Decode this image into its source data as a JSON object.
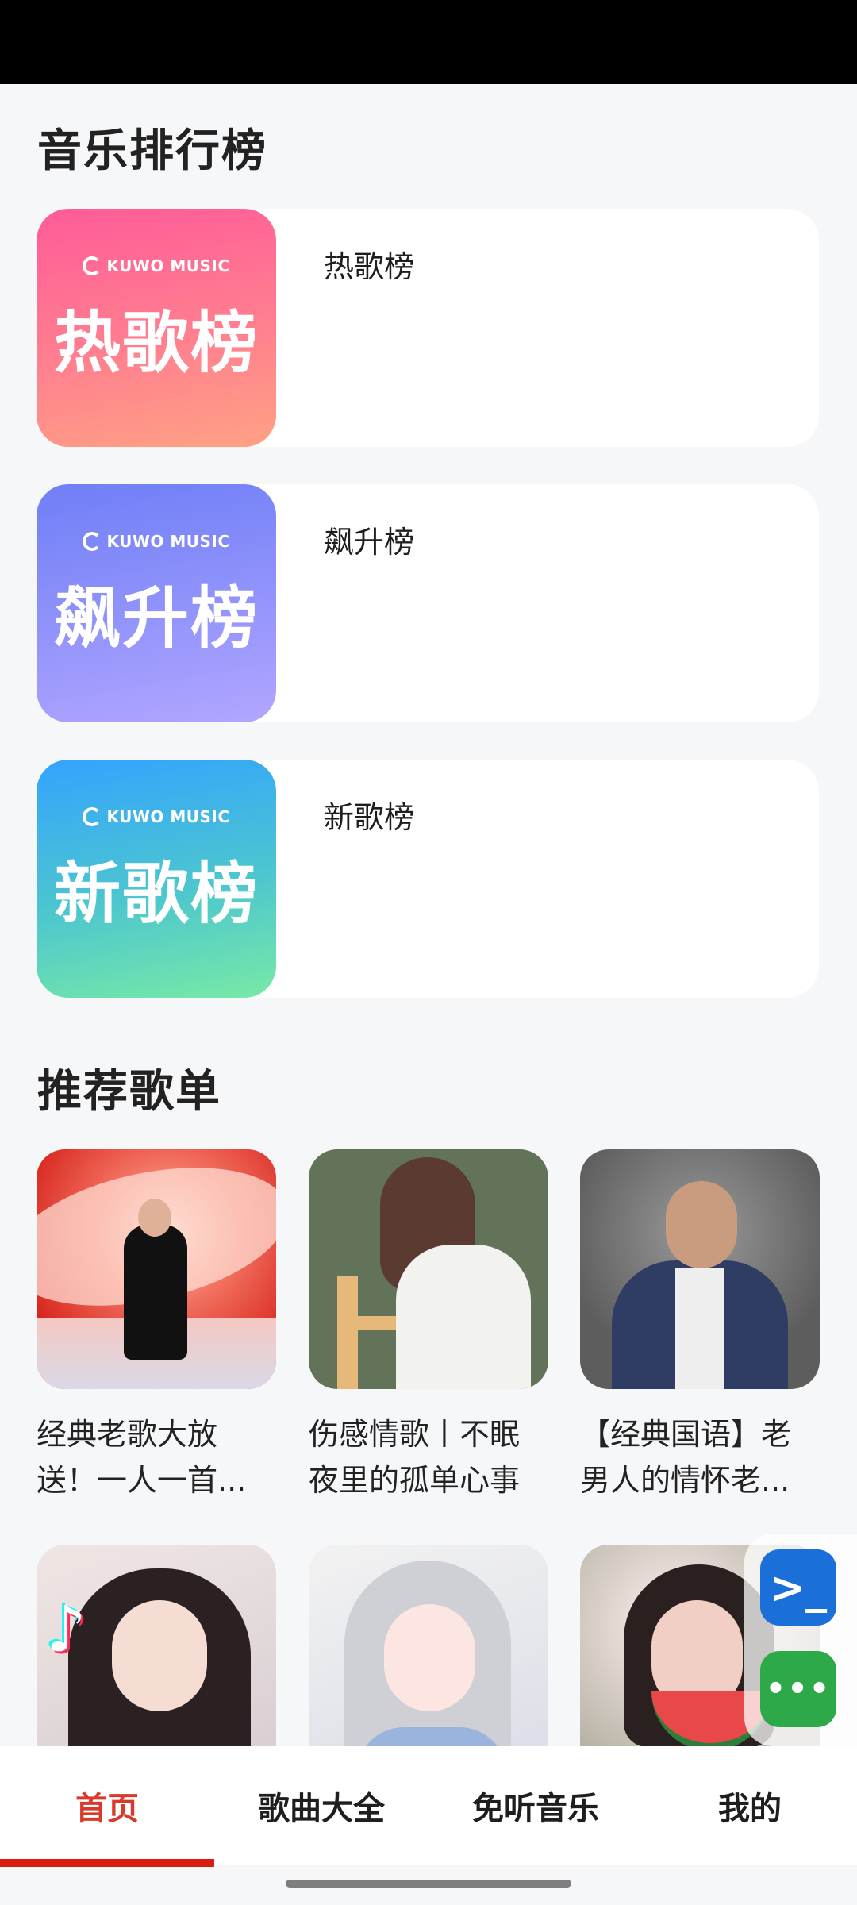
{
  "sections": {
    "rank_title": "音乐排行榜",
    "recommend_title": "推荐歌单"
  },
  "rankings": [
    {
      "name": "热歌榜",
      "cover_text": "热歌榜",
      "brand": "KUWO MUSIC"
    },
    {
      "name": "飙升榜",
      "cover_text": "飙升榜",
      "brand": "KUWO MUSIC"
    },
    {
      "name": "新歌榜",
      "cover_text": "新歌榜",
      "brand": "KUWO MUSIC"
    }
  ],
  "playlists": [
    {
      "title": "经典老歌大放送！一人一首..."
    },
    {
      "title": "伤感情歌丨不眠夜里的孤单心事"
    },
    {
      "title": "【经典国语】老男人的情怀老..."
    }
  ],
  "tabbar": {
    "items": [
      "首页",
      "歌曲大全",
      "免听音乐",
      "我的"
    ],
    "active": "首页"
  },
  "floating": {
    "terminal_glyph": ">_",
    "more_glyph": "•••"
  },
  "colors": {
    "accent": "#d83a2b",
    "tab_underline": "#d81e11"
  }
}
